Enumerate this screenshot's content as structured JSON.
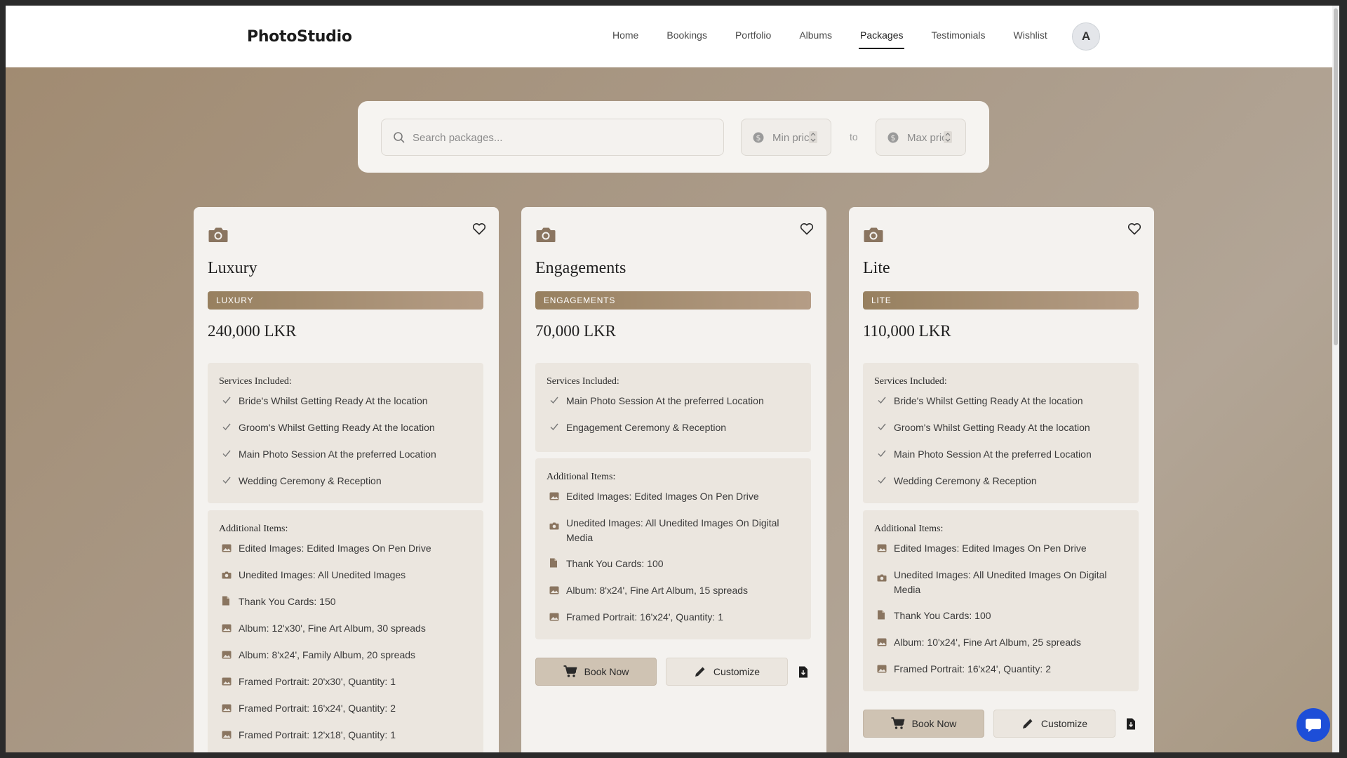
{
  "nav": {
    "brand": "PhotoStudio",
    "links": [
      "Home",
      "Bookings",
      "Portfolio",
      "Albums",
      "Packages",
      "Testimonials",
      "Wishlist"
    ],
    "avatar_letter": "A"
  },
  "search": {
    "placeholder": "Search packages...",
    "min_price_placeholder": "Min price",
    "max_price_placeholder": "Max price",
    "to_label": "to"
  },
  "labels": {
    "services_title": "Services Included:",
    "additional_title": "Additional Items:",
    "book_now": "Book Now",
    "customize": "Customize"
  },
  "packages": [
    {
      "title": "Luxury",
      "badge": "LUXURY",
      "price": "240,000 LKR",
      "services": [
        "Bride's Whilst Getting Ready At the location",
        "Groom's Whilst Getting Ready At the location",
        "Main Photo Session At the preferred Location",
        "Wedding Ceremony & Reception"
      ],
      "additional": [
        {
          "icon": "image-icon",
          "text": "Edited Images: Edited Images On Pen Drive"
        },
        {
          "icon": "camera-icon",
          "text": "Unedited Images: All Unedited Images"
        },
        {
          "icon": "document-icon",
          "text": "Thank You Cards: 150"
        },
        {
          "icon": "image-icon",
          "text": "Album: 12'x30', Fine Art Album, 30 spreads"
        },
        {
          "icon": "image-icon",
          "text": "Album: 8'x24', Family Album, 20 spreads"
        },
        {
          "icon": "image-icon",
          "text": "Framed Portrait: 20'x30', Quantity: 1"
        },
        {
          "icon": "image-icon",
          "text": "Framed Portrait: 16'x24', Quantity: 2"
        },
        {
          "icon": "image-icon",
          "text": "Framed Portrait: 12'x18', Quantity: 1"
        }
      ]
    },
    {
      "title": "Engagements",
      "badge": "ENGAGEMENTS",
      "price": "70,000 LKR",
      "services": [
        "Main Photo Session At the preferred Location",
        "Engagement Ceremony & Reception"
      ],
      "additional": [
        {
          "icon": "image-icon",
          "text": "Edited Images: Edited Images On Pen Drive"
        },
        {
          "icon": "camera-icon",
          "text": "Unedited Images: All Unedited Images On Digital Media"
        },
        {
          "icon": "document-icon",
          "text": "Thank You Cards: 100"
        },
        {
          "icon": "image-icon",
          "text": "Album: 8'x24', Fine Art Album, 15 spreads"
        },
        {
          "icon": "image-icon",
          "text": "Framed Portrait: 16'x24', Quantity: 1"
        }
      ]
    },
    {
      "title": "Lite",
      "badge": "LITE",
      "price": "110,000 LKR",
      "services": [
        "Bride's Whilst Getting Ready At the location",
        "Groom's Whilst Getting Ready At the location",
        "Main Photo Session At the preferred Location",
        "Wedding Ceremony & Reception"
      ],
      "additional": [
        {
          "icon": "image-icon",
          "text": "Edited Images: Edited Images On Pen Drive"
        },
        {
          "icon": "camera-icon",
          "text": "Unedited Images: All Unedited Images On Digital Media"
        },
        {
          "icon": "document-icon",
          "text": "Thank You Cards: 100"
        },
        {
          "icon": "image-icon",
          "text": "Album: 10'x24', Fine Art Album, 25 spreads"
        },
        {
          "icon": "image-icon",
          "text": "Framed Portrait: 16'x24', Quantity: 2"
        }
      ]
    }
  ]
}
